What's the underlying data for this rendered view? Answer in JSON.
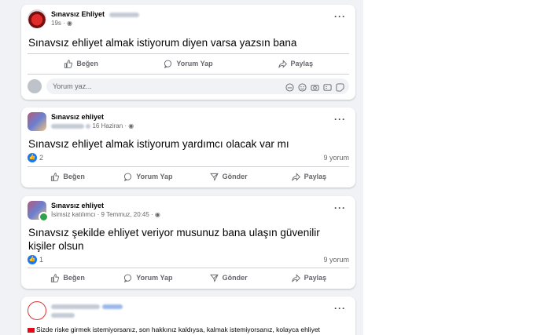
{
  "posts": [
    {
      "author": "Sınavsız Ehliyet",
      "meta": "19s",
      "text": "Sınavsız ehliyet almak istiyorum diyen varsa yazsın bana",
      "actions": {
        "like": "Beğen",
        "comment": "Yorum Yap",
        "share": "Paylaş"
      },
      "comment_placeholder": "Yorum yaz..."
    },
    {
      "author": "Sınavsız ehliyet",
      "meta": "16 Haziran",
      "text": "Sınavsız ehliyet almak istiyorum yardımcı olacak var mı",
      "likes": "2",
      "comments": "9 yorum",
      "actions": {
        "like": "Beğen",
        "comment": "Yorum Yap",
        "send": "Gönder",
        "share": "Paylaş"
      }
    },
    {
      "author": "Sınavsız ehliyet",
      "meta": "İsimsiz katılımcı · 9 Temmuz, 20:45",
      "text_line1": "Sınavsız şekilde ehliyet veriyor musunuz bana ulaşın güvenilir",
      "text_line2": "kişiler olsun",
      "likes": "1",
      "comments": "9 yorum",
      "actions": {
        "like": "Beğen",
        "comment": "Yorum Yap",
        "send": "Gönder",
        "share": "Paylaş"
      }
    },
    {
      "text": "Sizde riske girmek istemiyorsanız, son hakkınız kaldıysa, kalmak istemiyorsanız, kolayca ehliyet"
    }
  ],
  "icons": {
    "like": "thumbs-up-icon",
    "comment": "speech-bubble-icon",
    "share": "share-arrow-icon",
    "send": "send-icon",
    "more": "more-dots-icon",
    "globe": "globe-icon"
  },
  "colors": {
    "feed_bg": "#f0f2f5",
    "like_blue": "#1877f2",
    "muted": "#65676b",
    "badge_green": "#31a24c"
  }
}
